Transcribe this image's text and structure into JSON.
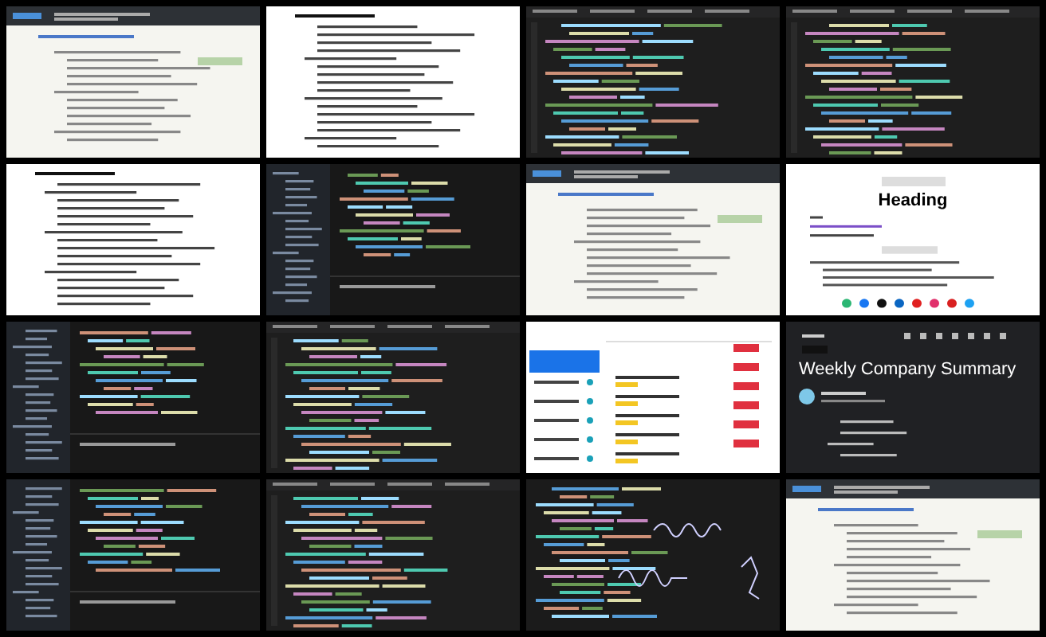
{
  "tiles": [
    {
      "kind": "web"
    },
    {
      "kind": "document"
    },
    {
      "kind": "code"
    },
    {
      "kind": "code"
    },
    {
      "kind": "document"
    },
    {
      "kind": "ide"
    },
    {
      "kind": "web"
    },
    {
      "kind": "email",
      "heading": "Heading"
    },
    {
      "kind": "ide"
    },
    {
      "kind": "code"
    },
    {
      "kind": "list"
    },
    {
      "kind": "mail",
      "title": "Weekly Company Summary"
    },
    {
      "kind": "ide"
    },
    {
      "kind": "code"
    },
    {
      "kind": "handwriting"
    },
    {
      "kind": "web"
    }
  ]
}
